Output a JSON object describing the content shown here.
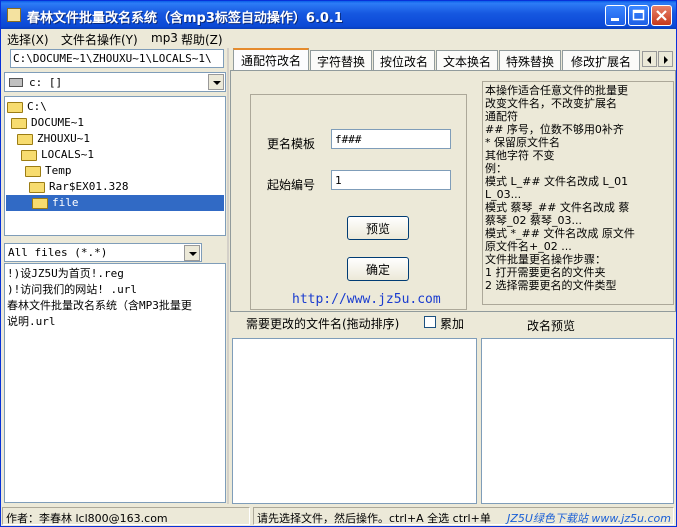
{
  "window": {
    "title": "春林文件批量改名系统（含mp3标签自动操作）6.0.1",
    "controls": {
      "minimize_icon": "minimize-icon",
      "maximize_icon": "maximize-icon",
      "close_icon": "close-icon"
    }
  },
  "menu": {
    "items": [
      {
        "label": "选择(X)"
      },
      {
        "label": "文件名操作(Y)"
      },
      {
        "label": "mp3"
      },
      {
        "label": "帮助(Z)"
      }
    ]
  },
  "left": {
    "path": "C:\\DOCUME~1\\ZHOUXU~1\\LOCALS~1\\",
    "drive": "c: []",
    "tree": [
      {
        "label": "C:\\"
      },
      {
        "label": "DOCUME~1"
      },
      {
        "label": "ZHOUXU~1"
      },
      {
        "label": "LOCALS~1"
      },
      {
        "label": "Temp"
      },
      {
        "label": "Rar$EX01.328"
      },
      {
        "label": "file"
      }
    ],
    "filter": "All files (*.*)",
    "files": [
      "!)设JZ5U为首页!.reg",
      ")!访问我们的网站! .url",
      "春林文件批量改名系统（含MP3批量更",
      "说明.url"
    ]
  },
  "tabs": [
    "通配符改名",
    "字符替换",
    "按位改名",
    "文本换名",
    "特殊替换",
    "修改扩展名"
  ],
  "form": {
    "template_label": "更名模板",
    "template_value": "f###",
    "start_label": "起始编号",
    "start_value": "1",
    "preview_button": "预览",
    "confirm_button": "确定",
    "link": "http://www.jz5u.com"
  },
  "help": {
    "lines": [
      "  本操作适合任意文件的批量更",
      "改变文件名，不改变扩展名",
      "通配符",
      "   ## 序号，位数不够用0补齐",
      "   * 保留原文件名",
      "   其他字符 不变",
      "例：",
      "   模式 L_## 文件名改成 L_01",
      "L_03...",
      "   模式 蔡琴_## 文件名改成 蔡",
      "蔡琴_02 蔡琴_03...",
      "   模式 *_## 文件名改成 原文件",
      "原文件名+_02 ...",
      "文件批量更名操作步骤：",
      "   1 打开需要更名的文件夹",
      "   2 选择需要更名的文件类型"
    ]
  },
  "lists": {
    "source_header": "需要更改的文件名(拖动排序)",
    "accumulate_label": "累加",
    "preview_header": "改名预览"
  },
  "status": {
    "author": "作者：李春林 lcl800@163.com",
    "message": "请先选择文件，然后操作。ctrl+A 全选  ctrl+单",
    "watermark": "JZ5U绿色下载站 www.jz5u.com"
  },
  "colors": {
    "title_bar": "#0a5fe8",
    "selection": "#316ac5",
    "link": "#1a3ccf",
    "tab_accent": "#e68b2c"
  }
}
